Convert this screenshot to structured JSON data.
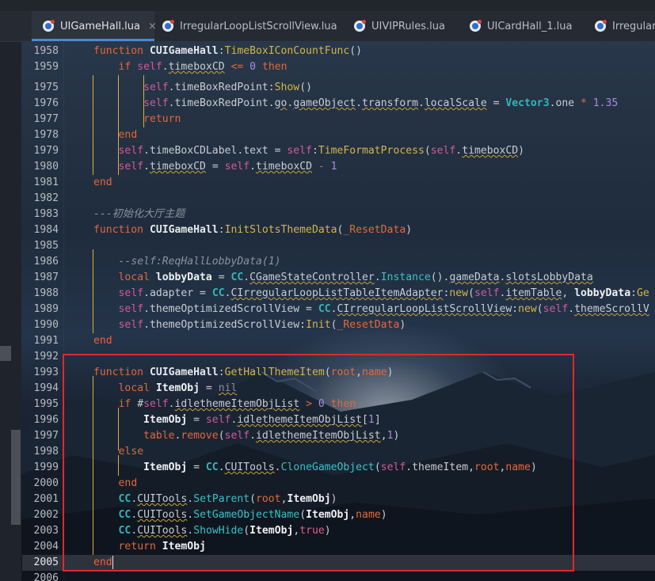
{
  "tabs": [
    {
      "label": "UIGameHall.lua",
      "active": true,
      "close": "×"
    },
    {
      "label": "IrregularLoopListScrollView.lua",
      "active": false
    },
    {
      "label": "UIVIPRules.lua",
      "active": false
    },
    {
      "label": "UICardHall_1.lua",
      "active": false
    },
    {
      "label": "IrregularL",
      "active": false
    }
  ],
  "current_line": "2005",
  "lines": [
    {
      "n": "1958",
      "html": "<span class='kw'>function</span> <span class='cls'>CUIGameHall</span>:<span class='fn'>TimeBoxIConCountFunc</span>()"
    },
    {
      "n": "1959",
      "html": "    <span class='kw'>if</span> <span class='self'>self</span>.<span class='u'>timeboxCD</span> <span class='op'>&lt;=</span> <span class='num'>0</span> <span class='kw'>then</span>"
    },
    {
      "n": "1975",
      "html": "        <span class='self'>self</span>.timeBoxRedPoint:<span class='fn'>Show</span>()"
    },
    {
      "n": "1976",
      "html": "        <span class='self'>self</span>.timeBoxRedPoint.<span class='u'>go</span>.<span class='u'>gameObject</span>.<span class='u'>transform</span>.<span class='u'>localScale</span> = <span class='cl'>Vector3</span>.one <span class='op'>*</span> <span class='num'>1.35</span>"
    },
    {
      "n": "1977",
      "html": "        <span class='kw'>return</span>"
    },
    {
      "n": "1978",
      "html": "    <span class='kw'>end</span>"
    },
    {
      "n": "1979",
      "html": "    <span class='self'>self</span>.timeBoxCDLabel.text = <span class='self'>self</span>:<span class='fn'>TimeFormatProcess</span>(<span class='self'>self</span>.<span class='u'>timeboxCD</span>)"
    },
    {
      "n": "1980",
      "html": "    <span class='self'>self</span>.<span class='u'>timeboxCD</span> = <span class='self'>self</span>.<span class='u'>timeboxCD</span> <span class='op'>-</span> <span class='num'>1</span>"
    },
    {
      "n": "1981",
      "html": "<span class='kw'>end</span>"
    },
    {
      "n": "1982",
      "html": ""
    },
    {
      "n": "1983",
      "html": "<span class='cm'>---初始化大厅主题</span>"
    },
    {
      "n": "1984",
      "html": "<span class='kw'>function</span> <span class='cls'>CUIGameHall</span>:<span class='fn'>InitSlotsThemeData</span>(<span class='op'>_ResetData</span>)"
    },
    {
      "n": "1985",
      "html": ""
    },
    {
      "n": "1986",
      "html": "    <span class='cm'>--self:ReqHallLobbyData(1)</span>"
    },
    {
      "n": "1987",
      "html": "    <span class='kw'>local</span> <span class='bold'>lobbyData</span> = <span class='cl'>CC</span>.<span class='u'>CGameStateController</span>.<span class='teal'>Instance</span>().<span class='u'>gameData</span>.<span class='u'>slotsLobbyData</span>"
    },
    {
      "n": "1988",
      "html": "    <span class='self'>self</span>.adapter = <span class='cl'>CC</span>.<span class='u'>CIrregularLoopListTableItemAdapter</span>:<span class='fn'>new</span>(<span class='self'>self</span>.<span class='u'>itemTable</span>, <span class='bold'>lobbyData</span>:<span class='fn'>Ge</span>"
    },
    {
      "n": "1989",
      "html": "    <span class='self'>self</span>.themeOptimizedScrollView = <span class='cl'>CC</span>.<span class='u'>CIrregularLoopListScrollView</span>:<span class='fn'>new</span>(<span class='self'>self</span>.<span class='u'>themeScrollV</span>"
    },
    {
      "n": "1990",
      "html": "    <span class='self'>self</span>.themeOptimizedScrollView:<span class='fn'>Init</span>(<span class='op'>_ResetData</span>)"
    },
    {
      "n": "1991",
      "html": "<span class='kw'>end</span>"
    },
    {
      "n": "1992",
      "html": ""
    },
    {
      "n": "1993",
      "html": "<span class='kw'>function</span> <span class='cls'>CUIGameHall</span>:<span class='fn'>GetHallThemeItem</span>(<span class='op'>root</span>,<span class='op'>name</span>)"
    },
    {
      "n": "1994",
      "html": "    <span class='kw'>local</span> <span class='bold'>ItemObj</span> = <span class='nil u'>nil</span>"
    },
    {
      "n": "1995",
      "html": "    <span class='kw'>if</span> #<span class='self'>self</span>.<span class='u'>idlethemeItemObjList</span> <span class='op'>&gt;</span> <span class='num'>0</span> <span class='kw'>then</span>"
    },
    {
      "n": "1996",
      "html": "        <span class='bold'>ItemObj</span> = <span class='self'>self</span>.<span class='u'>idlethemeItemObjList</span>[<span class='num'>1</span>]"
    },
    {
      "n": "1997",
      "html": "        <span class='kw'>table</span>.<span class='kw'>remove</span>(<span class='self'>self</span>.<span class='u'>idlethemeItemObjList</span>,<span class='num'>1</span>)"
    },
    {
      "n": "1998",
      "html": "    <span class='kw'>else</span>"
    },
    {
      "n": "1999",
      "html": "        <span class='bold'>ItemObj</span> = <span class='cl'>CC</span>.<span class='u'>CUITools</span>.<span class='teal'>CloneGameObject</span>(<span class='self'>self</span>.themeItem,<span class='op'>root</span>,<span class='op'>name</span>)"
    },
    {
      "n": "2000",
      "html": "    <span class='kw'>end</span>"
    },
    {
      "n": "2001",
      "html": "    <span class='cl'>CC</span>.<span class='u'>CUITools</span>.<span class='teal'>SetParent</span>(<span class='op'>root</span>,<span class='bold'>ItemObj</span>)"
    },
    {
      "n": "2002",
      "html": "    <span class='cl'>CC</span>.<span class='u'>CUITools</span>.<span class='teal'>SetGameObjectName</span>(<span class='bold'>ItemObj</span>,<span class='op'>name</span>)"
    },
    {
      "n": "2003",
      "html": "    <span class='cl'>CC</span>.<span class='u'>CUITools</span>.<span class='teal'>ShowHide</span>(<span class='bold'>ItemObj</span>,<span class='bool'>true</span>)"
    },
    {
      "n": "2004",
      "html": "    <span class='kw'>return</span> <span class='bold'>ItemObj</span>"
    },
    {
      "n": "2005",
      "html": "<span class='kw'>end</span><span class='caret'></span>"
    },
    {
      "n": "2006",
      "html": ""
    }
  ],
  "colors": {
    "keyword": "#e0683a",
    "function": "#d3b64a",
    "self": "#d2599e",
    "number": "#a98be0",
    "comment": "#8d939b",
    "highlight_box": "#e0282e",
    "active_tab_underline": "#4a88d9"
  },
  "icons": {
    "tab_file": "lua-file-icon",
    "tab_close": "close-icon"
  }
}
